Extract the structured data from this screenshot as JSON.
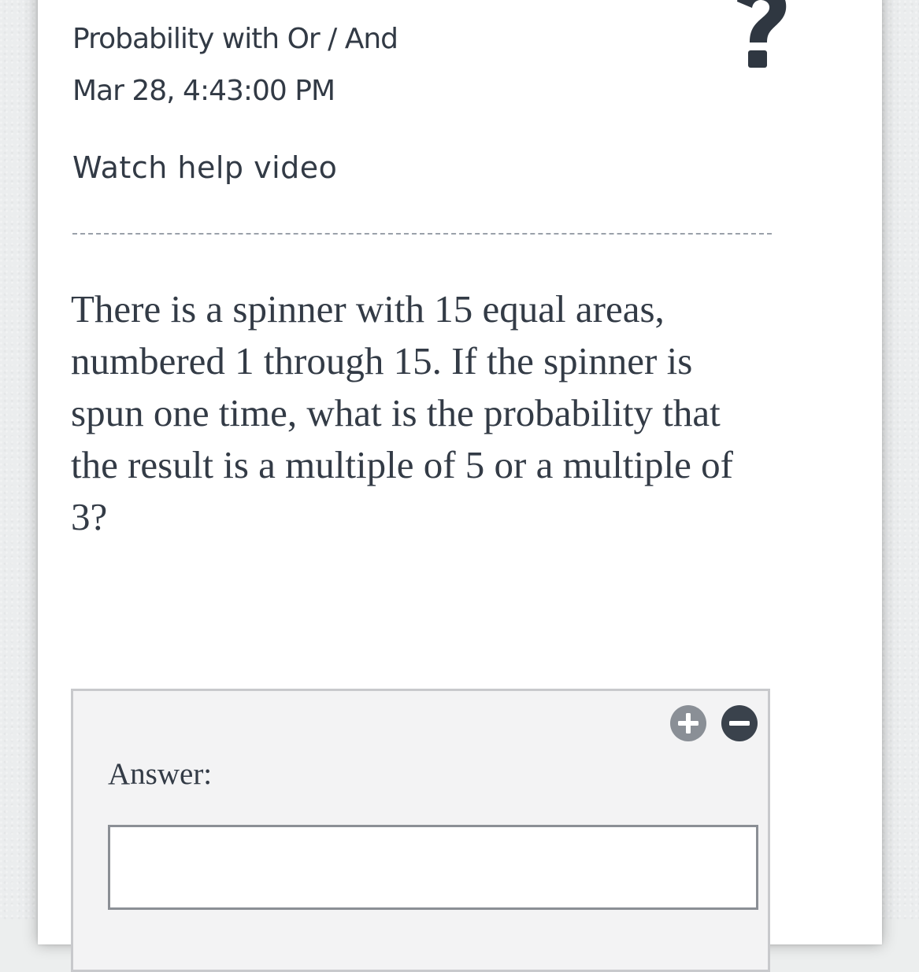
{
  "header": {
    "title": "Probability with Or / And",
    "datetime": "Mar 28, 4:43:00 PM",
    "help_link": "Watch help video",
    "help_icon": "question-mark-icon"
  },
  "question": {
    "text": "There is a spinner with 15 equal areas, numbered 1 through 15. If the spinner is spun one time, what is the probability that the result is a multiple of 5 or a multiple of 3?"
  },
  "answer": {
    "label": "Answer:",
    "value": "",
    "add_icon": "plus-circle-icon",
    "remove_icon": "minus-circle-icon"
  },
  "colors": {
    "text": "#323a45",
    "plus_button": "#8a8f96",
    "minus_button": "#3a424c",
    "answer_panel": "#f3f3f4"
  }
}
